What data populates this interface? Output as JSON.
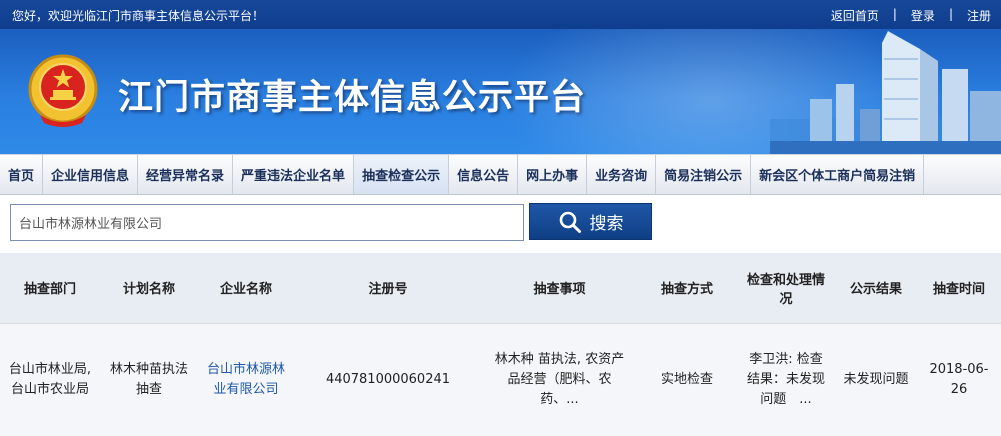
{
  "topbar": {
    "welcome": "您好，欢迎光临江门市商事主体信息公示平台！",
    "links": [
      "返回首页",
      "登录",
      "注册"
    ],
    "separator": "|"
  },
  "banner": {
    "title": "江门市商事主体信息公示平台",
    "emblem_icon": "national-emblem-icon",
    "skyline_icon": "city-skyline-illustration"
  },
  "nav": {
    "items": [
      "首页",
      "企业信用信息",
      "经营异常名录",
      "严重违法企业名单",
      "抽查检查公示",
      "信息公告",
      "网上办事",
      "业务咨询",
      "简易注销公示",
      "新会区个体工商户简易注销"
    ],
    "active_index": 4
  },
  "search": {
    "value": "台山市林源林业有限公司",
    "button_label": "搜索",
    "button_icon": "search-icon"
  },
  "table": {
    "headers": [
      "抽查部门",
      "计划名称",
      "企业名称",
      "注册号",
      "抽查事项",
      "抽查方式",
      "检查和处理情况",
      "公示结果",
      "抽查时间"
    ],
    "rows": [
      [
        "台山市林业局, 台山市农业局",
        "林木种苗执法抽查",
        "台山市林源林业有限公司",
        "440781000060241",
        "林木种 苗执法, 农资产品经营（肥料、农药、...",
        "实地检查",
        "李卫洪: 检查结果：未发现问题　...",
        "未发现问题",
        "2018-06-26"
      ]
    ]
  },
  "colors": {
    "topbar": "#17489a",
    "banner": "#2a7fe0",
    "search_button": "#1a4d99",
    "link": "#1f5aa8"
  }
}
